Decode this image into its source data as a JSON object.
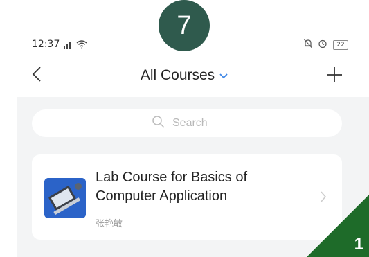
{
  "status_bar": {
    "time": "12:37",
    "battery": "22"
  },
  "badges": {
    "top_step": "7",
    "corner_step": "1"
  },
  "nav": {
    "title": "All Courses"
  },
  "search": {
    "placeholder": "Search"
  },
  "course": {
    "title": "Lab Course for Basics of Computer Application",
    "teacher": "张艳敏"
  },
  "colors": {
    "step_badge": "#2f5a4d",
    "corner_badge": "#1e6b29",
    "chevron_accent": "#3d86e6",
    "course_thumb": "#2b63c8",
    "content_bg": "#f3f4f5"
  }
}
